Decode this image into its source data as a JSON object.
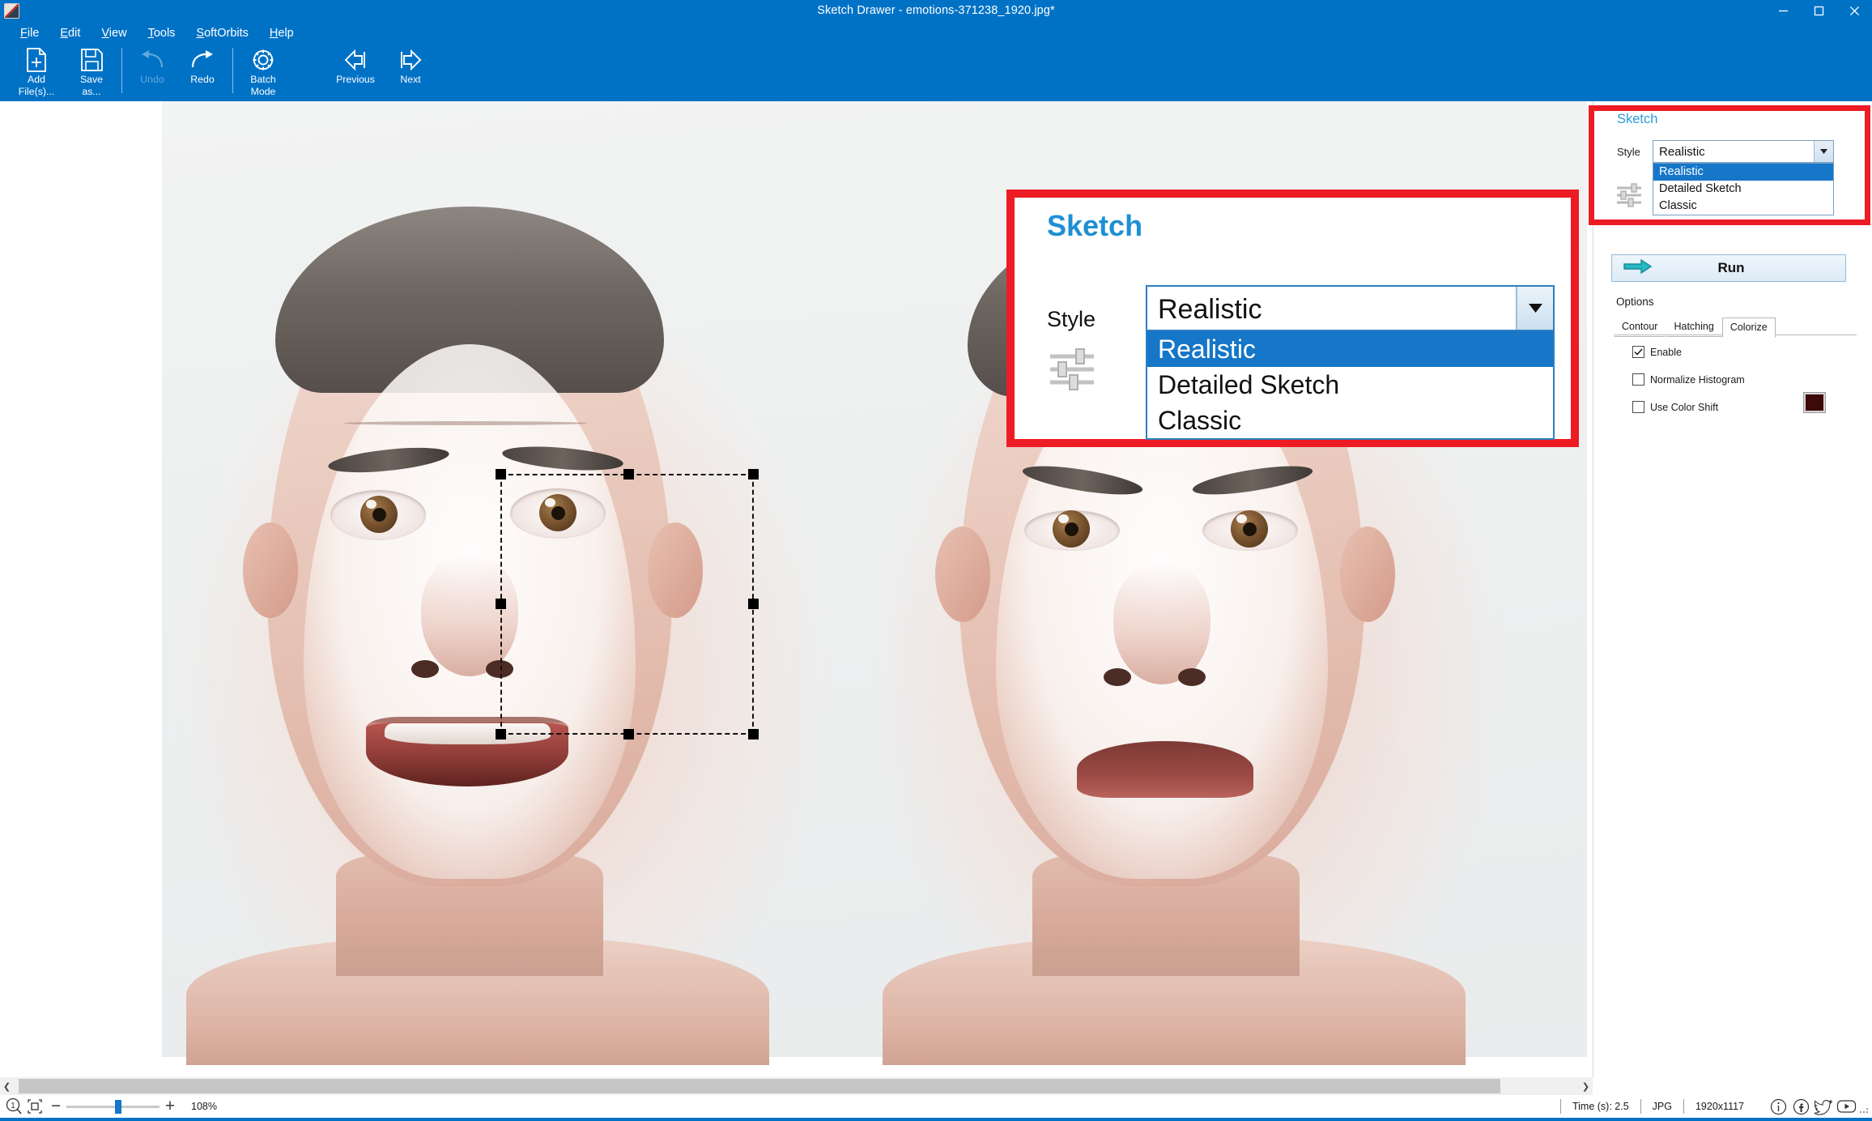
{
  "window": {
    "title": "Sketch Drawer - emotions-371238_1920.jpg*",
    "minimize_label": "Minimize",
    "maximize_label": "Maximize",
    "close_label": "Close"
  },
  "menu": {
    "items": [
      {
        "label": "File",
        "mnemonic": "F"
      },
      {
        "label": "Edit",
        "mnemonic": "E"
      },
      {
        "label": "View",
        "mnemonic": "V"
      },
      {
        "label": "Tools",
        "mnemonic": "T"
      },
      {
        "label": "SoftOrbits",
        "mnemonic": "S"
      },
      {
        "label": "Help",
        "mnemonic": "H"
      }
    ]
  },
  "toolbar": {
    "add_files_line1": "Add",
    "add_files_line2": "File(s)...",
    "save_as_line1": "Save",
    "save_as_line2": "as...",
    "undo": "Undo",
    "redo": "Redo",
    "batch_line1": "Batch",
    "batch_line2": "Mode",
    "previous": "Previous",
    "next": "Next"
  },
  "panel": {
    "title": "Sketch",
    "style_label": "Style",
    "style_value": "Realistic",
    "style_options": [
      "Realistic",
      "Detailed Sketch",
      "Classic"
    ],
    "style_selected_index": 0,
    "run_label": "Run",
    "options_label": "Options",
    "tabs": [
      {
        "label": "Contour",
        "active": false
      },
      {
        "label": "Hatching",
        "active": false
      },
      {
        "label": "Colorize",
        "active": true
      }
    ],
    "checkboxes": [
      {
        "label": "Enable",
        "checked": true
      },
      {
        "label": "Normalize Histogram",
        "checked": false
      },
      {
        "label": "Use Color Shift",
        "checked": false
      }
    ],
    "color_swatch": "#3d0a0a"
  },
  "callout": {
    "title": "Sketch",
    "style_label": "Style",
    "style_value": "Realistic",
    "options": [
      "Realistic",
      "Detailed Sketch",
      "Classic"
    ],
    "selected_index": 0,
    "border_color": "#ed1c24"
  },
  "statusbar": {
    "zoom_percent": "108%",
    "time": "Time (s): 2.5",
    "format": "JPG",
    "dimensions": "1920x1117",
    "social": [
      "info-icon",
      "facebook-icon",
      "twitter-icon",
      "youtube-icon"
    ]
  },
  "colors": {
    "titlebar": "#0072c6",
    "accent": "#0072c6",
    "highlight": "#1676c8",
    "panel_heading": "#2e9ad6",
    "callout_red": "#ed1c24"
  }
}
